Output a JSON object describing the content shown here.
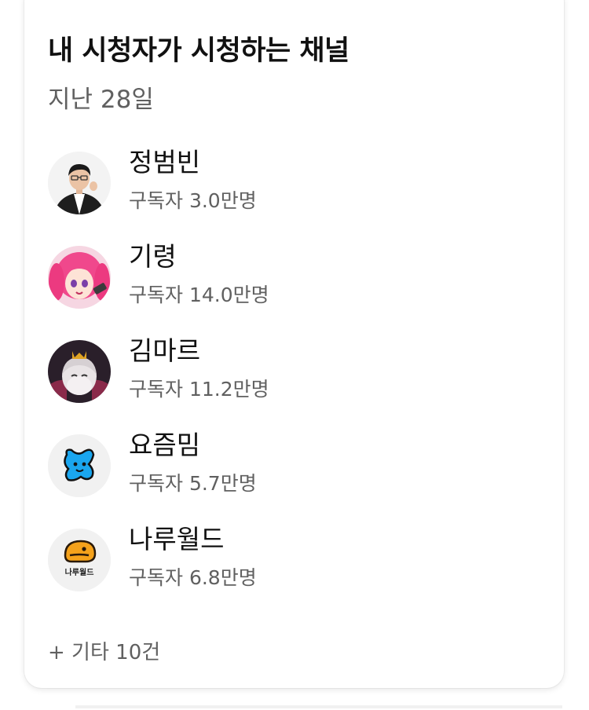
{
  "card": {
    "title": "내 시청자가 시청하는 채널",
    "subtitle": "지난 28일",
    "more_label": "+ 기타 10건"
  },
  "channels": [
    {
      "name": "정범빈",
      "subscribers": "구독자 3.0만명",
      "avatar_icon": "man-in-suit-avatar-icon"
    },
    {
      "name": "기령",
      "subscribers": "구독자 14.0만명",
      "avatar_icon": "pink-haired-anime-avatar-icon"
    },
    {
      "name": "김마르",
      "subscribers": "구독자 11.2만명",
      "avatar_icon": "crowned-character-avatar-icon"
    },
    {
      "name": "요즘밈",
      "subscribers": "구독자 5.7만명",
      "avatar_icon": "blue-blob-avatar-icon"
    },
    {
      "name": "나루월드",
      "subscribers": "구독자 6.8만명",
      "avatar_icon": "naruworld-logo-avatar-icon",
      "avatar_logo_text": "나루월드"
    }
  ],
  "colors": {
    "title": "#111111",
    "secondary_text": "#606060",
    "card_background": "#ffffff"
  }
}
